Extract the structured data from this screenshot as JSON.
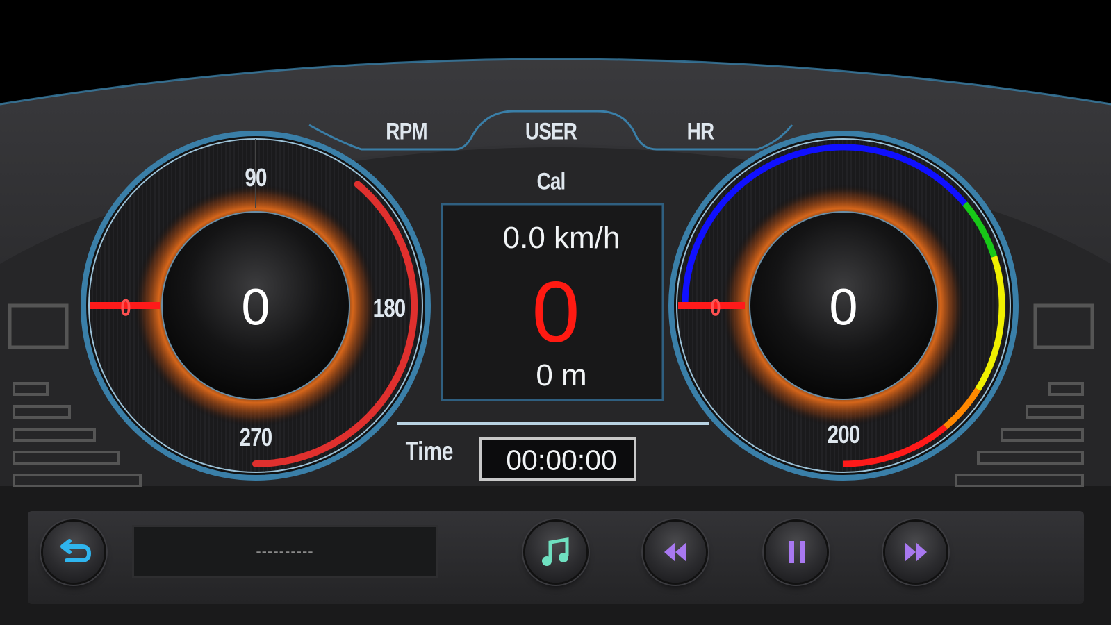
{
  "tabs": [
    {
      "label": "RPM"
    },
    {
      "label": "USER"
    },
    {
      "label": "HR"
    }
  ],
  "left_gauge": {
    "name_tab": "RPM",
    "value": "0",
    "ticks": [
      "0",
      "90",
      "180",
      "270"
    ],
    "arc_color": "#e0302e",
    "needle_color": "#ff1a1a"
  },
  "center_panel": {
    "title": "Cal",
    "speed": "0.0 km/h",
    "calories": "0",
    "distance": "0 m",
    "time_label": "Time",
    "time_value": "00:00:00"
  },
  "right_gauge": {
    "name_tab": "HR",
    "value": "0",
    "ticks": [
      "0",
      "200"
    ],
    "zones": [
      "#1010ff",
      "#18c818",
      "#f0f000",
      "#ff8800",
      "#ff1a1a"
    ],
    "needle_color": "#ff1a1a"
  },
  "media_bar": {
    "song_text": "----------",
    "buttons": [
      {
        "name": "back-button",
        "icon": "return-arrow-icon"
      },
      {
        "name": "music-button",
        "icon": "music-note-icon"
      },
      {
        "name": "rewind-button",
        "icon": "rewind-icon"
      },
      {
        "name": "pause-button",
        "icon": "pause-icon"
      },
      {
        "name": "fast-forward-button",
        "icon": "fast-forward-icon"
      }
    ]
  },
  "colors": {
    "accent_blue": "#3a7fa8",
    "glow_orange": "#e06a1a",
    "panel_dark": "#1c1c1e"
  }
}
